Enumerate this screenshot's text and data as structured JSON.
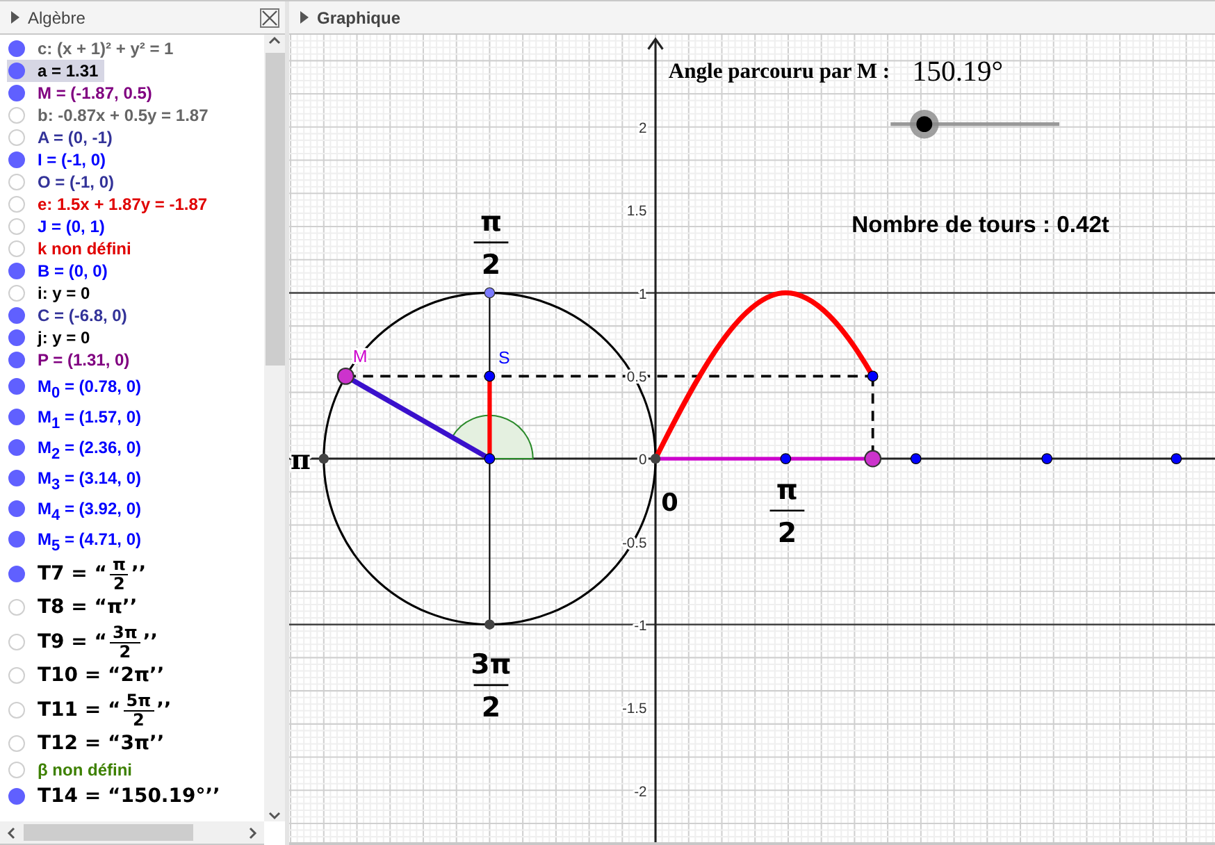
{
  "algebra": {
    "title": "Algèbre",
    "items": [
      {
        "kind": "text",
        "text": "c: (x + 1)² + y² = 1",
        "color": "#666666",
        "shown": true,
        "selected": false
      },
      {
        "kind": "text",
        "text": "a = 1.31",
        "color": "#000000",
        "shown": true,
        "selected": true
      },
      {
        "kind": "text",
        "text": "M = (-1.87, 0.5)",
        "color": "#800080",
        "shown": true,
        "selected": false
      },
      {
        "kind": "text",
        "text": "b: -0.87x + 0.5y = 1.87",
        "color": "#666666",
        "shown": false,
        "selected": false
      },
      {
        "kind": "text",
        "text": "A = (0, -1)",
        "color": "#333399",
        "shown": false,
        "selected": false
      },
      {
        "kind": "text",
        "text": "I = (-1, 0)",
        "color": "#0000ff",
        "shown": true,
        "selected": false
      },
      {
        "kind": "text",
        "text": "O = (-1, 0)",
        "color": "#333399",
        "shown": false,
        "selected": false
      },
      {
        "kind": "text",
        "text": "e: 1.5x + 1.87y = -1.87",
        "color": "#e00000",
        "shown": false,
        "selected": false
      },
      {
        "kind": "text",
        "text": "J = (0, 1)",
        "color": "#0000ff",
        "shown": false,
        "selected": false
      },
      {
        "kind": "text",
        "text": "k non défini",
        "color": "#e00000",
        "shown": false,
        "selected": false
      },
      {
        "kind": "text",
        "text": "B = (0, 0)",
        "color": "#0000ff",
        "shown": true,
        "selected": false
      },
      {
        "kind": "text",
        "text": "i: y = 0",
        "color": "#000000",
        "shown": false,
        "selected": false
      },
      {
        "kind": "text",
        "text": "C = (-6.8, 0)",
        "color": "#333399",
        "shown": true,
        "selected": false
      },
      {
        "kind": "text",
        "text": "j: y = 0",
        "color": "#000000",
        "shown": true,
        "selected": false
      },
      {
        "kind": "text",
        "text": "P = (1.31, 0)",
        "color": "#800080",
        "shown": true,
        "selected": false
      },
      {
        "kind": "text",
        "text": "M$_{0}$ = (0.78, 0)",
        "color": "#0000ff",
        "shown": true,
        "selected": false
      },
      {
        "kind": "text",
        "text": "M$_{1}$ = (1.57, 0)",
        "color": "#0000ff",
        "shown": true,
        "selected": false
      },
      {
        "kind": "text",
        "text": "M$_{2}$ = (2.36, 0)",
        "color": "#0000ff",
        "shown": true,
        "selected": false
      },
      {
        "kind": "text",
        "text": "M$_{3}$ = (3.14, 0)",
        "color": "#0000ff",
        "shown": true,
        "selected": false
      },
      {
        "kind": "text",
        "text": "M$_{4}$ = (3.92, 0)",
        "color": "#0000ff",
        "shown": true,
        "selected": false
      },
      {
        "kind": "text",
        "text": "M$_{5}$ = (4.71, 0)",
        "color": "#0000ff",
        "shown": true,
        "selected": false
      },
      {
        "kind": "fraction",
        "prefix": "T7 = “",
        "numerator": "π",
        "denominator": "2",
        "suffix": "’’",
        "color": "#000000",
        "shown": true,
        "selected": false
      },
      {
        "kind": "formula",
        "text": "T8 = “π’’",
        "color": "#000000",
        "shown": false,
        "selected": false
      },
      {
        "kind": "fraction",
        "prefix": "T9 = “",
        "numerator": "3π",
        "denominator": "2",
        "suffix": "’’",
        "color": "#000000",
        "shown": false,
        "selected": false
      },
      {
        "kind": "formula",
        "text": "T10 = “2π’’",
        "color": "#000000",
        "shown": false,
        "selected": false
      },
      {
        "kind": "fraction",
        "prefix": "T11 = “",
        "numerator": "5π",
        "denominator": "2",
        "suffix": "’’",
        "color": "#000000",
        "shown": false,
        "selected": false
      },
      {
        "kind": "formula",
        "text": "T12 = “3π’’",
        "color": "#000000",
        "shown": false,
        "selected": false
      },
      {
        "kind": "text",
        "text": "β non défini",
        "color": "#3d8000",
        "shown": false,
        "selected": false
      },
      {
        "kind": "formula",
        "text": "T14 = “150.19°’’",
        "color": "#000000",
        "shown": true,
        "selected": false
      }
    ]
  },
  "graphics": {
    "title": "Graphique",
    "angle_caption": "Angle parcouru par M :",
    "angle_value": "150.19°",
    "slider": {
      "level": 0.2
    },
    "turns": "Nombre de tours : 0.42t",
    "y_ticks": [
      "2",
      "1.5",
      "1",
      "0.5",
      "0",
      "-0.5",
      "-1",
      "-1.5",
      "-2"
    ],
    "top_label": {
      "numerator": "π",
      "denominator": "2"
    },
    "left_label": "π",
    "bottom_label": {
      "numerator": "3π",
      "denominator": "2"
    },
    "origin_label": "0",
    "axis_label": {
      "numerator": "π",
      "denominator": "2"
    },
    "point_labels": [
      "M",
      "S"
    ]
  }
}
